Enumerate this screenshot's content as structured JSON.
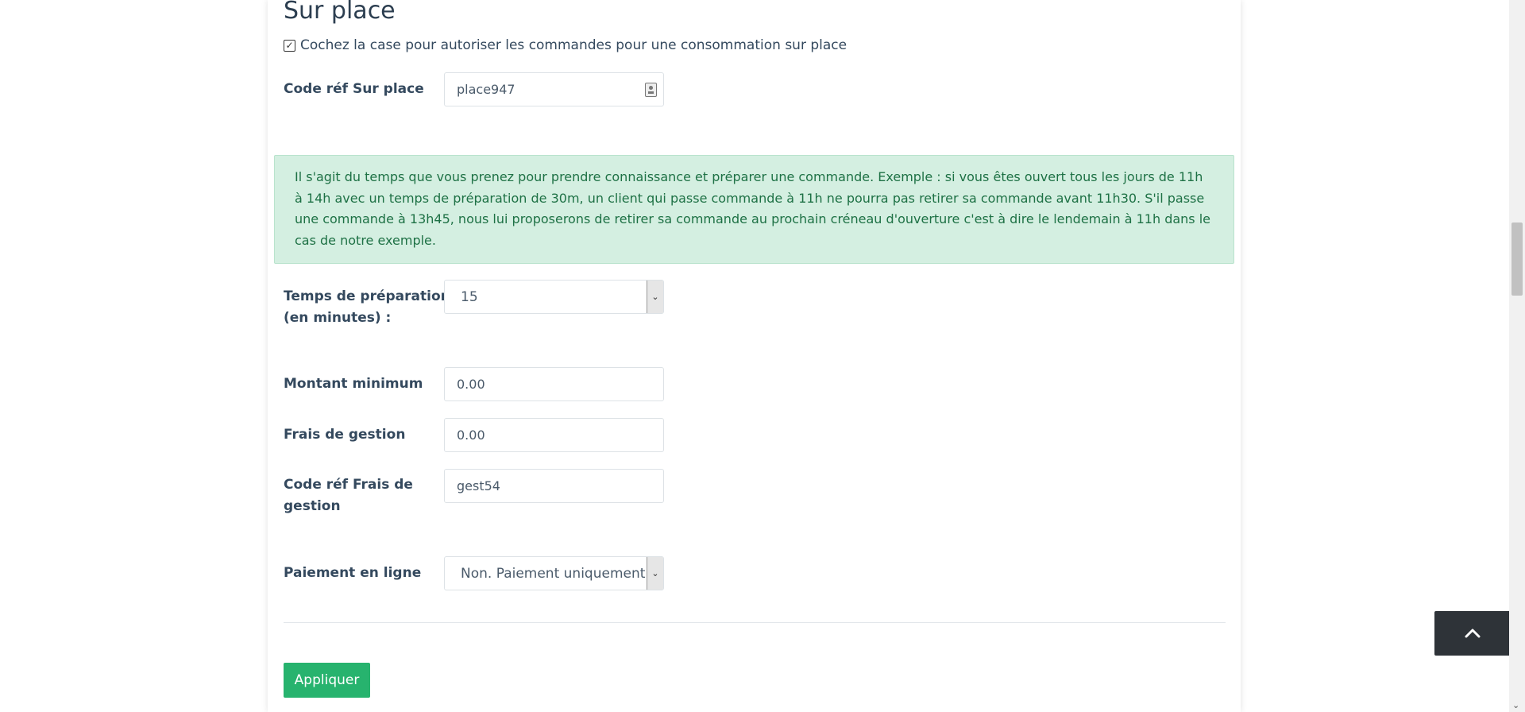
{
  "section": {
    "title": "Sur place",
    "checkbox_label": "Cochez la case pour autoriser les commandes pour une consommation sur place",
    "checkbox_checked": true
  },
  "fields": {
    "code_ref_label": "Code réf Sur place",
    "code_ref_value": "place947",
    "info_text": "Il s'agit du temps que vous prenez pour prendre connaissance et préparer une commande. Exemple : si vous êtes ouvert tous les jours de 11h à 14h avec un temps de préparation de 30m, un client qui passe commande à 11h ne pourra pas retirer sa commande avant 11h30. S'il passe une commande à 13h45, nous lui proposerons de retirer sa commande au prochain créneau d'ouverture c'est à dire le lendemain à 11h dans le cas de notre exemple.",
    "prep_time_label_line1": "Temps de préparation",
    "prep_time_label_line2": "(en minutes) :",
    "prep_time_value": "15",
    "min_amount_label": "Montant minimum",
    "min_amount_value": "0.00",
    "fees_label": "Frais de gestion",
    "fees_value": "0.00",
    "fees_code_label_line1": "Code réf Frais de",
    "fees_code_label_line2": "gestion",
    "fees_code_value": "gest54",
    "online_payment_label": "Paiement en ligne",
    "online_payment_value": "Non. Paiement uniquement au"
  },
  "actions": {
    "apply_label": "Appliquer"
  },
  "icons": {
    "checkbox": "checkbox-checked-icon",
    "contact_card": "contact-card-icon",
    "select_arrow": "chevron-down-icon",
    "back_to_top": "chevron-up-icon"
  },
  "colors": {
    "primary_button": "#27b36e",
    "alert_background": "#d4efe1",
    "alert_text": "#1e7145",
    "back_to_top_bg": "#2e3338"
  }
}
